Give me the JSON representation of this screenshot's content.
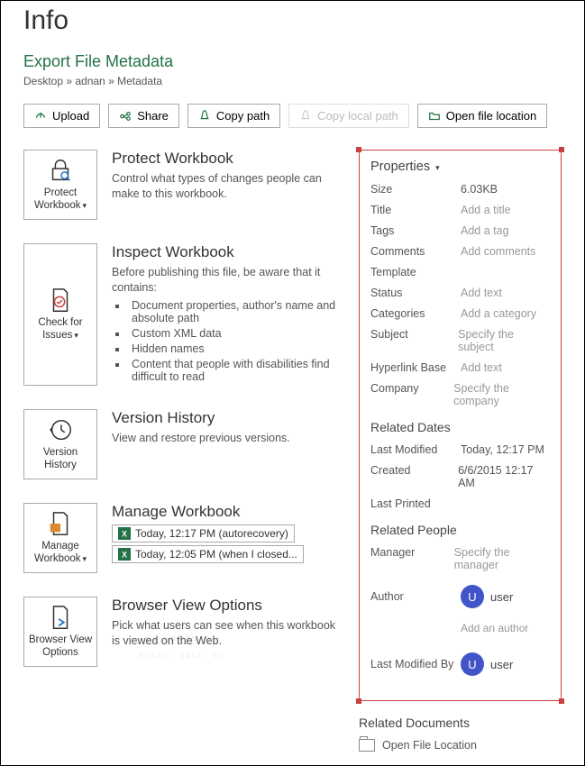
{
  "page_title": "Info",
  "file_name": "Export File Metadata",
  "breadcrumb": "Desktop » adnan » Metadata",
  "toolbar": {
    "upload": "Upload",
    "share": "Share",
    "copy_path": "Copy path",
    "copy_local": "Copy local path",
    "open_loc": "Open file location"
  },
  "sections": {
    "protect": {
      "tile": "Protect Workbook",
      "title": "Protect Workbook",
      "desc": "Control what types of changes people can make to this workbook."
    },
    "inspect": {
      "tile": "Check for Issues",
      "title": "Inspect Workbook",
      "desc": "Before publishing this file, be aware that it contains:",
      "bullets": [
        "Document properties, author's name and absolute path",
        "Custom XML data",
        "Hidden names",
        "Content that people with disabilities find difficult to read"
      ]
    },
    "version": {
      "tile": "Version History",
      "title": "Version History",
      "desc": "View and restore previous versions."
    },
    "manage": {
      "tile": "Manage Workbook",
      "title": "Manage Workbook",
      "items": [
        "Today, 12:17 PM (autorecovery)",
        "Today, 12:05 PM (when I closed..."
      ]
    },
    "browser": {
      "tile": "Browser View Options",
      "title": "Browser View Options",
      "desc": "Pick what users can see when this workbook is viewed on the Web."
    }
  },
  "properties": {
    "header": "Properties",
    "rows": [
      {
        "label": "Size",
        "value": "6.03KB",
        "placeholder": false
      },
      {
        "label": "Title",
        "value": "Add a title",
        "placeholder": true
      },
      {
        "label": "Tags",
        "value": "Add a tag",
        "placeholder": true
      },
      {
        "label": "Comments",
        "value": "Add comments",
        "placeholder": true
      },
      {
        "label": "Template",
        "value": "",
        "placeholder": false
      },
      {
        "label": "Status",
        "value": "Add text",
        "placeholder": true
      },
      {
        "label": "Categories",
        "value": "Add a category",
        "placeholder": true
      },
      {
        "label": "Subject",
        "value": "Specify the subject",
        "placeholder": true
      },
      {
        "label": "Hyperlink Base",
        "value": "Add text",
        "placeholder": true
      },
      {
        "label": "Company",
        "value": "Specify the company",
        "placeholder": true
      }
    ],
    "related_dates_header": "Related Dates",
    "dates": [
      {
        "label": "Last Modified",
        "value": "Today, 12:17 PM"
      },
      {
        "label": "Created",
        "value": "6/6/2015 12:17 AM"
      },
      {
        "label": "Last Printed",
        "value": ""
      }
    ],
    "related_people_header": "Related People",
    "manager_label": "Manager",
    "manager_value": "Specify the manager",
    "author_label": "Author",
    "author_user": "user",
    "author_initial": "U",
    "add_author": "Add an author",
    "last_modified_label": "Last Modified By",
    "last_modified_user": "user",
    "last_modified_initial": "U"
  },
  "related_docs": {
    "header": "Related Documents",
    "open_loc": "Open File Location"
  },
  "watermark": "exceldemy",
  "watermark_sub": "EXCEL · DATA · BI"
}
